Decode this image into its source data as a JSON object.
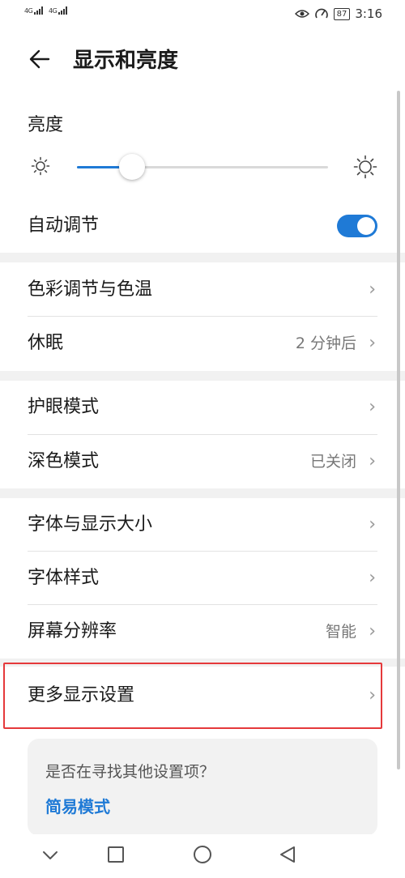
{
  "status": {
    "sim1": "4G",
    "sim2": "4G",
    "battery": "87",
    "time": "3:16"
  },
  "header": {
    "title": "显示和亮度"
  },
  "brightness": {
    "label": "亮度",
    "level": 0.22
  },
  "auto_adjust": {
    "label": "自动调节",
    "enabled": true
  },
  "rows": {
    "color_temp": {
      "label": "色彩调节与色温"
    },
    "sleep": {
      "label": "休眠",
      "value": "2 分钟后"
    },
    "eye_comfort": {
      "label": "护眼模式"
    },
    "dark_mode": {
      "label": "深色模式",
      "value": "已关闭"
    },
    "font_display_size": {
      "label": "字体与显示大小"
    },
    "font_style": {
      "label": "字体样式"
    },
    "resolution": {
      "label": "屏幕分辨率",
      "value": "智能"
    },
    "more_display": {
      "label": "更多显示设置"
    }
  },
  "chevron": "›",
  "suggest": {
    "question": "是否在寻找其他设置项？",
    "link": "简易模式"
  },
  "colors": {
    "accent": "#1f7ad6",
    "highlight": "#e5393b"
  },
  "icons": [
    "back-arrow-icon",
    "eye-icon",
    "speed-icon",
    "battery-icon",
    "sun-small-icon",
    "sun-large-icon",
    "chevron-right-icon",
    "nav-back-icon",
    "nav-home-icon",
    "nav-recents-icon",
    "nav-hide-icon"
  ]
}
